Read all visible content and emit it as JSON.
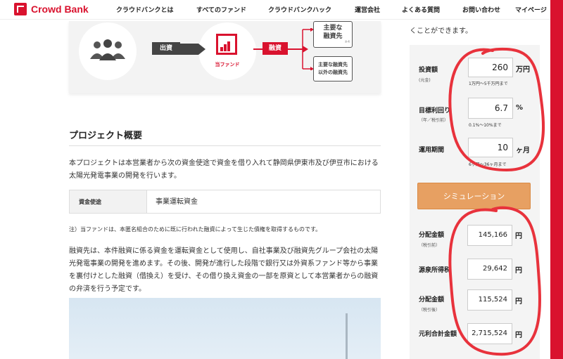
{
  "header": {
    "logo_text": "Crowd Bank",
    "nav": [
      "クラウドバンクとは",
      "すべてのファンド",
      "クラウドバンクハック",
      "運営会社",
      "よくある質問",
      "お問い合わせ",
      "マイページ"
    ]
  },
  "diagram": {
    "tag_investment": "出資",
    "tag_loan": "融資",
    "fund_label": "当ファンド",
    "box_main_line1": "主要な",
    "box_main_line2": "融資先",
    "box_main_note": "※4",
    "box_other_line1": "主要な融資先",
    "box_other_line2": "以外の融資先"
  },
  "project": {
    "title": "プロジェクト概要",
    "para1": "本プロジェクトは本営業者から次の資金使途で資金を借り入れて静岡県伊東市及び伊豆市における太陽光発電事業の開発を行います。",
    "usage_head": "資金使途",
    "usage_value": "事業運転資金",
    "note": "注）当ファンドは、本匿名組合のために既に行われた融資によって生じた債権を取得するものです。",
    "para2": "融資先は、本件融資に係る資金を運転資金として使用し、自社事業及び融資先グループ会社の太陽光発電事業の開発を進めます。その後、開発が進行した段階で銀行又は外資系ファンド等から事業を裏付けとした融資（借換え）を受け、その借り換え資金の一部を原資として本営業者からの融資の弁済を行う予定です。"
  },
  "simulator": {
    "intro": "くことができます。",
    "investment_label": "投資額",
    "investment_sub": "(元金)",
    "investment_value": "260",
    "investment_unit": "万円",
    "investment_hint": "1万円〜5千万円まで",
    "yield_label": "目標利回り",
    "yield_sub": "（年／税引前）",
    "yield_value": "6.7",
    "yield_unit": "%",
    "yield_hint": "0.1%〜10%まで",
    "period_label": "運用期間",
    "period_value": "10",
    "period_unit": "ヶ月",
    "period_hint": "6ヶ月〜36ヶ月まで",
    "button_label": "シミュレーション",
    "dist_pre_label": "分配金額",
    "dist_pre_sub": "（税引前）",
    "dist_pre_value": "145,166",
    "withholding_label": "源泉所得税",
    "withholding_value": "29,642",
    "dist_post_label": "分配金額",
    "dist_post_sub": "（税引後）",
    "dist_post_value": "115,524",
    "total_label": "元利合計金額",
    "total_value": "2,715,524",
    "yen": "円"
  },
  "colors": {
    "brand_red": "#d9122e",
    "button_orange": "#e7a062",
    "annotation_red": "#e8323c"
  }
}
